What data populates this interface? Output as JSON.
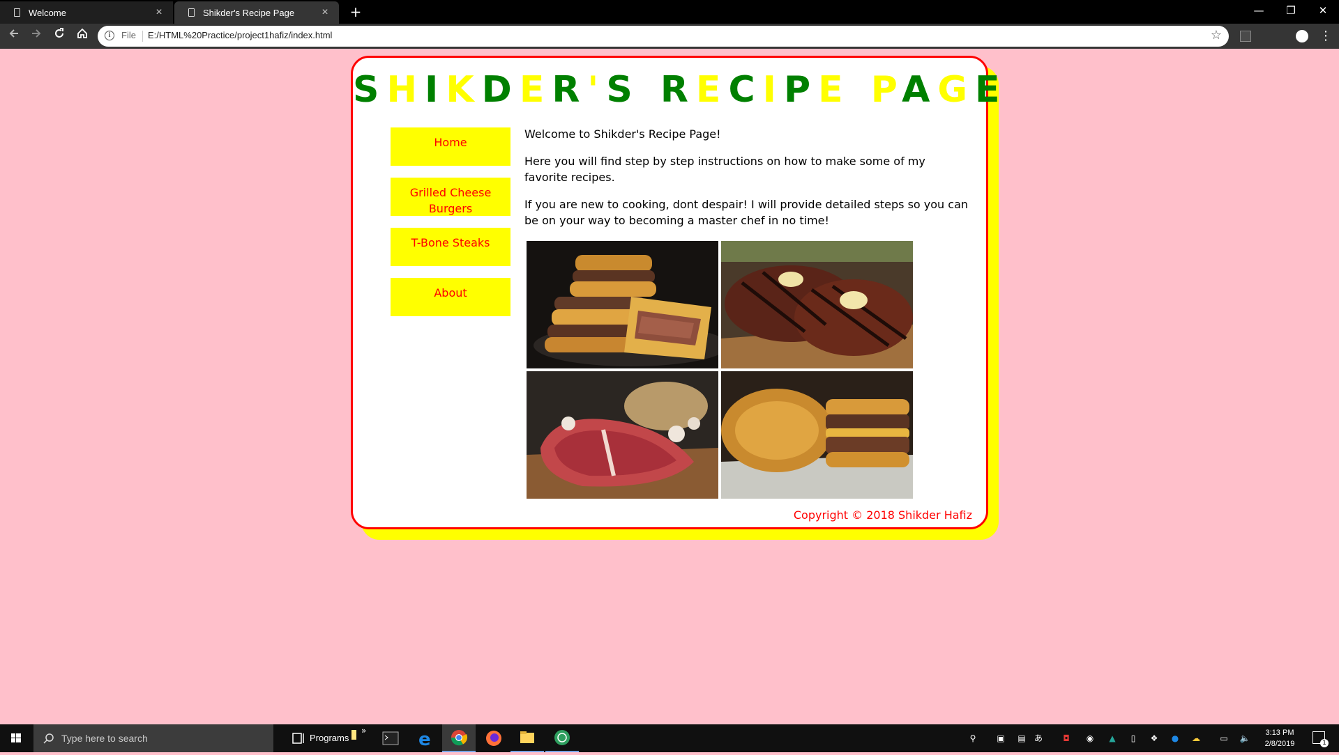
{
  "browser": {
    "tabs": [
      {
        "title": "Welcome",
        "close": "×"
      },
      {
        "title": "Shikder's Recipe Page",
        "close": "×"
      }
    ],
    "new_tab": "+",
    "window_controls": [
      "—",
      "❐",
      "✕"
    ],
    "address": {
      "scheme_label": "File",
      "url": "E:/HTML%20Practice/project1hafiz/index.html"
    }
  },
  "page": {
    "title_letters": [
      {
        "ch": "S",
        "color": "#008000"
      },
      {
        "ch": "H",
        "color": "#ffff00"
      },
      {
        "ch": "I",
        "color": "#008000"
      },
      {
        "ch": "K",
        "color": "#ffff00"
      },
      {
        "ch": "D",
        "color": "#008000"
      },
      {
        "ch": "E",
        "color": "#ffff00"
      },
      {
        "ch": "R",
        "color": "#008000"
      },
      {
        "ch": "'",
        "color": "#ffff00"
      },
      {
        "ch": "S",
        "color": "#008000"
      },
      {
        "ch": " ",
        "color": "#008000"
      },
      {
        "ch": "R",
        "color": "#008000"
      },
      {
        "ch": "E",
        "color": "#ffff00"
      },
      {
        "ch": "C",
        "color": "#008000"
      },
      {
        "ch": "I",
        "color": "#ffff00"
      },
      {
        "ch": "P",
        "color": "#008000"
      },
      {
        "ch": "E",
        "color": "#ffff00"
      },
      {
        "ch": " ",
        "color": "#008000"
      },
      {
        "ch": "P",
        "color": "#ffff00"
      },
      {
        "ch": "A",
        "color": "#008000"
      },
      {
        "ch": "G",
        "color": "#ffff00"
      },
      {
        "ch": "E",
        "color": "#008000"
      }
    ],
    "nav": [
      {
        "label": "Home"
      },
      {
        "label": "Grilled Cheese Burgers"
      },
      {
        "label": "T-Bone Steaks"
      },
      {
        "label": "About"
      }
    ],
    "welcome": "Welcome to Shikder's Recipe Page!",
    "intro": "Here you will find step by step instructions on how to make some of my favorite recipes.",
    "encourage": "If you are new to cooking, dont despair! I will provide detailed steps so you can be on your way to becoming a master chef in no time!",
    "footer": "Copyright © 2018 Shikder Hafiz"
  },
  "taskbar": {
    "search_placeholder": "Type here to search",
    "programs_label": "Programs",
    "time": "3:13 PM",
    "date": "2/8/2019",
    "notification_count": "1"
  },
  "colors": {
    "page_bg": "#ffc0cb",
    "card_border": "#ff0000",
    "card_shadow": "#ffff00",
    "nav_bg": "#ffff00",
    "nav_text": "#ff0000",
    "title_green": "#008000",
    "title_yellow": "#ffff00"
  }
}
